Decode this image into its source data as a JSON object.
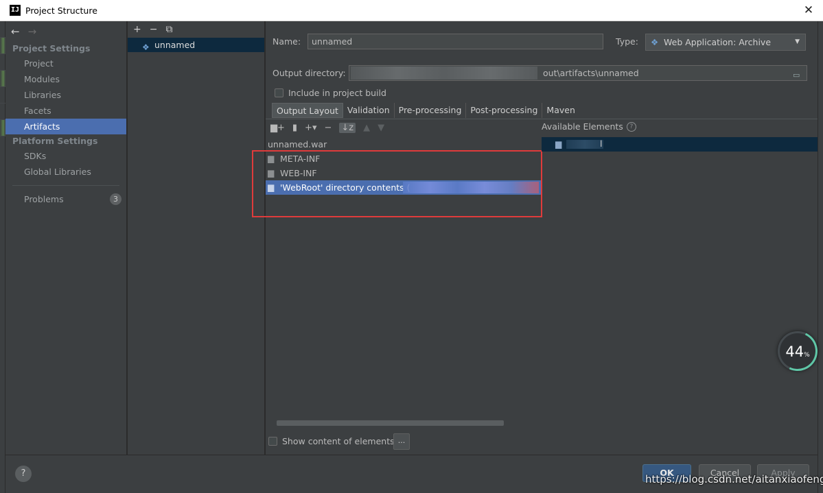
{
  "window": {
    "title": "Project Structure",
    "app_icon": "IJ",
    "close": "✕"
  },
  "sidebar": {
    "back": "←",
    "forward": "→",
    "section_project": "Project Settings",
    "items_project": [
      "Project",
      "Modules",
      "Libraries",
      "Facets",
      "Artifacts"
    ],
    "selected": "Artifacts",
    "section_platform": "Platform Settings",
    "items_platform": [
      "SDKs",
      "Global Libraries"
    ],
    "problems_label": "Problems",
    "problems_count": "3"
  },
  "artifacts_list": {
    "add": "+",
    "remove": "−",
    "copy": "⧉",
    "items": [
      {
        "name": "unnamed"
      }
    ]
  },
  "main": {
    "name_label": "Name:",
    "name_value": "unnamed",
    "type_label": "Type:",
    "type_value": "Web Application: Archive",
    "output_dir_label": "Output directory:",
    "output_dir_value": "out\\artifacts\\unnamed",
    "include_in_build_label": "Include in project build",
    "tabs": [
      "Output Layout",
      "Validation",
      "Pre-processing",
      "Post-processing",
      "Maven"
    ],
    "active_tab": "Output Layout",
    "layout_tree": {
      "root": "unnamed.war",
      "children": [
        "META-INF",
        "WEB-INF",
        "'WebRoot' directory contents ("
      ]
    },
    "available_elements_label": "Available Elements",
    "available_item_suffix": "l",
    "show_content_label": "Show content of elements",
    "dots_button": "..."
  },
  "footer": {
    "help": "?",
    "ok": "OK",
    "cancel": "Cancel",
    "apply": "Apply"
  },
  "overlay": {
    "widget_percent": "44",
    "widget_unit": "%",
    "watermark": "https://blog.csdn.net/aitanxiaofeng"
  },
  "colors": {
    "selection": "#4b6eaf",
    "panel": "#3c3f41",
    "highlight_box": "#e03b3b"
  }
}
